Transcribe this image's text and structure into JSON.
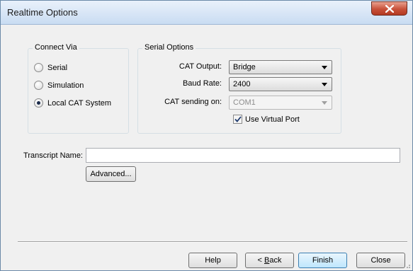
{
  "window": {
    "title": "Realtime Options"
  },
  "connect_via": {
    "label": "Connect Via",
    "options": [
      {
        "label": "Serial",
        "checked": false
      },
      {
        "label": "Simulation",
        "checked": false
      },
      {
        "label": "Local CAT System",
        "checked": true
      }
    ]
  },
  "serial_options": {
    "label": "Serial Options",
    "cat_output_label": "CAT Output:",
    "cat_output_value": "Bridge",
    "baud_rate_label": "Baud Rate:",
    "baud_rate_value": "2400",
    "cat_sending_label": "CAT sending on:",
    "cat_sending_value": "COM1",
    "virtual_port_label": "Use Virtual Port",
    "virtual_port_checked": true
  },
  "transcript": {
    "label": "Transcript Name:",
    "value": "",
    "advanced_label": "Advanced..."
  },
  "buttons": {
    "help": "Help",
    "back_prefix": "< ",
    "back_accel": "B",
    "back_rest": "ack",
    "finish": "Finish",
    "close": "Close"
  }
}
